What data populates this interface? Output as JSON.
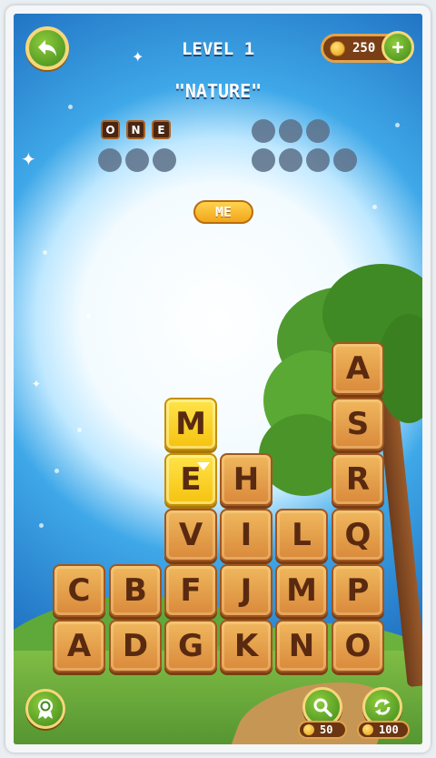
{
  "header": {
    "level": "LEVEL 1",
    "coins": "250",
    "category": "\"NATURE\""
  },
  "found_words": [
    {
      "letters": [
        "O",
        "N",
        "E"
      ]
    }
  ],
  "current_word": "ME",
  "grid": {
    "columns": [
      [
        "A",
        "C"
      ],
      [
        "D",
        "B"
      ],
      [
        "G",
        "F",
        "V",
        "E",
        "M"
      ],
      [
        "K",
        "J",
        "I",
        "H"
      ],
      [
        "N",
        "M",
        "L"
      ],
      [
        "O",
        "P",
        "Q",
        "R",
        "S",
        "A"
      ]
    ],
    "selected": [
      "M",
      "E"
    ]
  },
  "buttons": {
    "hint_cost": "50",
    "shuffle_cost": "100"
  },
  "icons": {
    "back": "back-arrow-icon",
    "add_coins": "plus-icon",
    "badge": "ribbon-badge-icon",
    "hint": "magnifier-icon",
    "shuffle": "shuffle-icon",
    "coin": "coin-icon"
  },
  "colors": {
    "tile": "#e4a24d",
    "tile_selected": "#f5cd1d",
    "button_green": "#5aa02a",
    "sky": "#2b86d6"
  }
}
